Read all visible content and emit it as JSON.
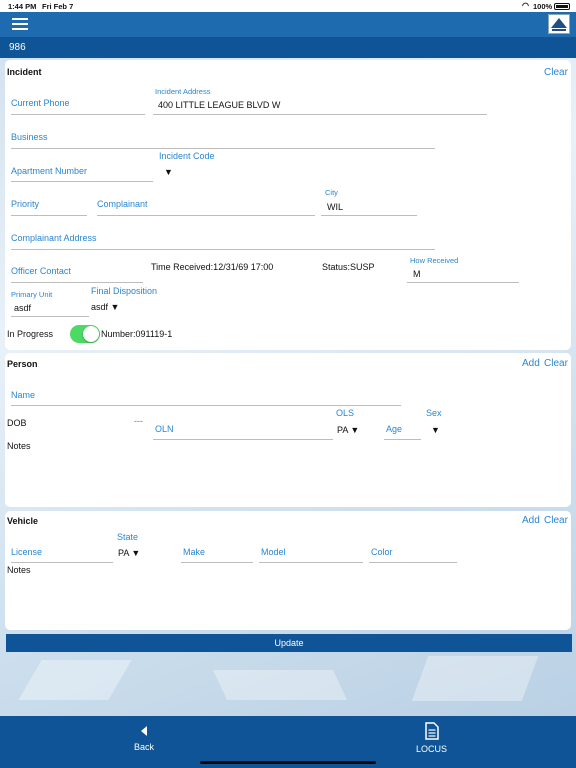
{
  "status_bar": {
    "time": "1:44 PM",
    "date": "Fri Feb 7",
    "battery": "100%"
  },
  "header": {
    "record_id": "986"
  },
  "incident": {
    "title": "Incident",
    "clear_label": "Clear",
    "current_phone_placeholder": "Current Phone",
    "incident_address_label": "Incident Address",
    "incident_address_value": "400 LITTLE LEAGUE BLVD W",
    "business_placeholder": "Business",
    "apartment_number_placeholder": "Apartment Number",
    "incident_code_label": "Incident Code",
    "incident_code_arrow": "▼",
    "priority_placeholder": "Priority",
    "complainant_placeholder": "Complainant",
    "city_label": "City",
    "city_value": "WIL",
    "complainant_address_placeholder": "Complainant Address",
    "officer_contact_placeholder": "Officer Contact",
    "time_received": "Time Received:12/31/69 17:00",
    "status": "Status:SUSP",
    "how_received_label": "How Received",
    "how_received_value": "M",
    "primary_unit_label": "Primary Unit",
    "primary_unit_value": "asdf",
    "final_disposition_label": "Final Disposition",
    "final_disposition_value": "asdf ▼",
    "in_progress_label": "In Progress",
    "in_progress_on": true,
    "number": "Number:091119-1"
  },
  "person": {
    "title": "Person",
    "add_label": "Add",
    "clear_label": "Clear",
    "name_placeholder": "Name",
    "dob_label": "DOB",
    "dob_dash": "---",
    "oln_placeholder": "OLN",
    "ols_label": "OLS",
    "ols_value": "PA ▼",
    "age_placeholder": "Age",
    "sex_label": "Sex",
    "sex_arrow": "▼",
    "notes_label": "Notes"
  },
  "vehicle": {
    "title": "Vehicle",
    "add_label": "Add",
    "clear_label": "Clear",
    "license_placeholder": "License",
    "state_label": "State",
    "state_value": "PA ▼",
    "make_placeholder": "Make",
    "model_placeholder": "Model",
    "color_placeholder": "Color",
    "notes_label": "Notes"
  },
  "update_label": "Update",
  "bottom_nav": {
    "back_label": "Back",
    "back_icon": "back-arrow-icon",
    "locus_label": "LOCUS",
    "locus_icon": "document-icon"
  },
  "colors": {
    "primary": "#0f5496",
    "accent": "#2a86d1",
    "toggle_on": "#4cd964"
  }
}
